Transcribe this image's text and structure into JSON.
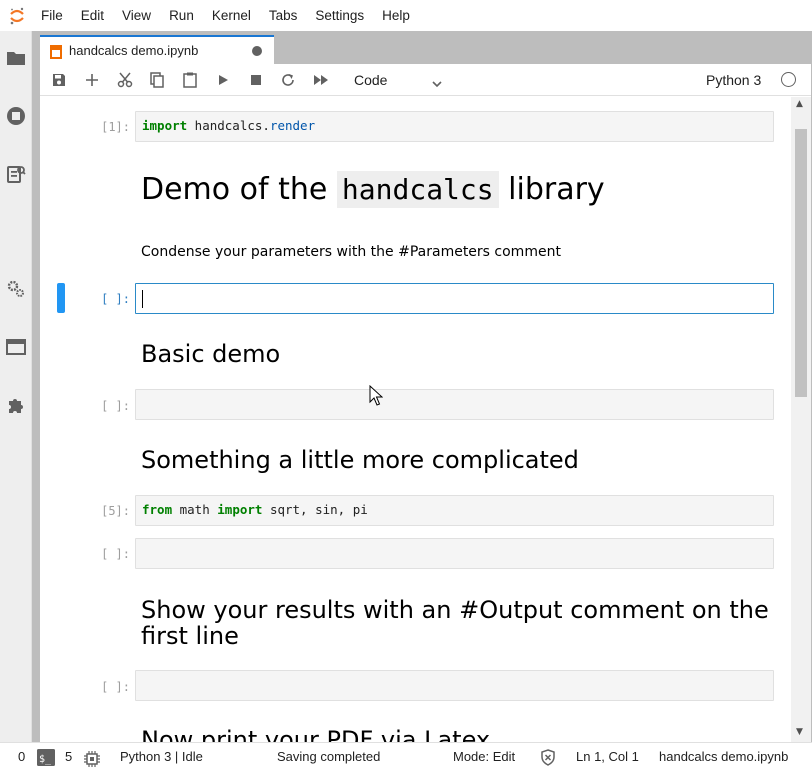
{
  "menubar": {
    "items": [
      "File",
      "Edit",
      "View",
      "Run",
      "Kernel",
      "Tabs",
      "Settings",
      "Help"
    ]
  },
  "sidebar": {
    "icons": [
      "folder-icon",
      "running-icon",
      "commands-icon",
      "property-inspector-icon",
      "tabs-icon",
      "extension-icon"
    ]
  },
  "tab": {
    "label": "handcalcs demo.ipynb"
  },
  "toolbar": {
    "cell_type": "Code",
    "kernel_name": "Python 3"
  },
  "cells": {
    "c1_prompt": "[1]:",
    "c1_kw": "import",
    "c1_rest": " handcalcs.",
    "c1_mod": "render",
    "md1_pre": "Demo of the ",
    "md1_code": "handcalcs",
    "md1_post": " library",
    "md2": "Condense your parameters with the #Parameters comment",
    "c2_prompt": "[ ]:",
    "md3": "Basic demo",
    "c3_prompt": "[ ]:",
    "md4": "Something a little more complicated",
    "c4_prompt": "[5]:",
    "c4_kw1": "from",
    "c4_mid": " math ",
    "c4_kw2": "import",
    "c4_rest": " sqrt, sin, pi",
    "c5_prompt": "[ ]:",
    "md5": "Show your results with an #Output comment on the first line",
    "c6_prompt": "[ ]:",
    "md6": "Now print your PDF via Latex"
  },
  "statusbar": {
    "terminals": "0",
    "kernels": "5",
    "kernel_status": "Python 3 | Idle",
    "save_status": "Saving completed",
    "mode": "Mode: Edit",
    "position": "Ln 1, Col 1",
    "filename": "handcalcs demo.ipynb"
  },
  "colors": {
    "accent": "#2196f3",
    "active_tab": "#1976d2",
    "sidebar_bg": "#eeeeee",
    "main_bg": "#bdbdbd"
  }
}
